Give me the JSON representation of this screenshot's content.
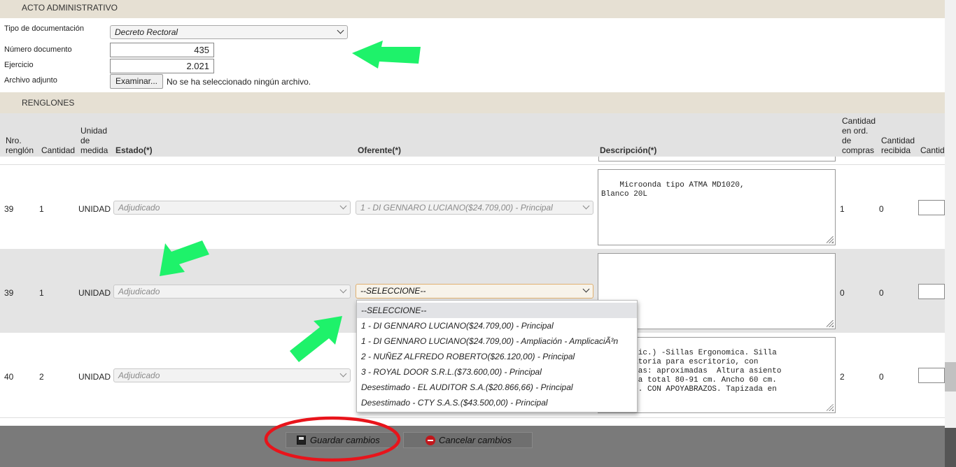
{
  "acto": {
    "header": "ACTO ADMINISTRATIVO",
    "tipo_label": "Tipo de documentación",
    "tipo_value": "Decreto Rectoral",
    "numero_label": "Número documento",
    "numero_value": "435",
    "ejercicio_label": "Ejercicio",
    "ejercicio_value": "2.021",
    "archivo_label": "Archivo adjunto",
    "examinar_label": "Examinar...",
    "archivo_status": "No se ha seleccionado ningún archivo."
  },
  "renglones": {
    "header": "RENGLONES",
    "columns": {
      "nro": "Nro.\nrenglón",
      "cantidad": "Cantidad",
      "unidad": "Unidad\nde\nmedida",
      "estado": "Estado(*)",
      "oferente": "Oferente(*)",
      "descripcion": "Descripción(*)",
      "cant_ord": "Cantidad\nen ord.\nde\ncompras",
      "cant_recibida": "Cantidad\nrecibida",
      "cant_extra": "Cantid"
    },
    "rows": [
      {
        "nro": "39",
        "cantidad": "1",
        "unidad": "UNIDAD",
        "estado": "Adjudicado",
        "oferente": "1 - DI GENNARO LUCIANO($24.709,00) - Principal",
        "descripcion": "Microonda tipo ATMA MD1020,\nBlanco 20L",
        "cant_ord": "1",
        "cant_recibida": "0"
      },
      {
        "nro": "39",
        "cantidad": "1",
        "unidad": "UNIDAD",
        "estado": "Adjudicado",
        "oferente": "--SELECCIONE--",
        "descripcion": "",
        "cant_ord": "0",
        "cant_recibida": "0"
      },
      {
        "nro": "40",
        "cantidad": "2",
        "unidad": "UNIDAD",
        "estado": "Adjudicado",
        "oferente": "",
        "descripcion": "a.Psic.) -Sillas Ergonomica. Silla\nica Giratoria para escritorio, con\ns. Medidas: aproximadas  Altura asiento\nn. Altura total 80-91 cm. Ancho 60 cm.\negulable. CON APOYABRAZOS. Tapizada en\n.-",
        "cant_ord": "2",
        "cant_recibida": "0"
      }
    ],
    "dropdown_options": [
      "--SELECCIONE--",
      "1 - DI GENNARO LUCIANO($24.709,00) - Principal",
      "1 - DI GENNARO LUCIANO($24.709,00) - Ampliación - AmplicaciÃ³n",
      "2 - NUÑEZ ALFREDO ROBERTO($26.120,00) - Principal",
      "3 - ROYAL DOOR S.R.L.($73.600,00) - Principal",
      "Desestimado - EL AUDITOR S.A.($20.866,66) - Principal",
      "Desestimado - CTY S.A.S.($43.500,00) - Principal"
    ]
  },
  "footer": {
    "guardar_label": "Guardar cambios",
    "cancelar_label": "Cancelar cambios"
  },
  "colors": {
    "section_header": "#e6e0d3",
    "annotation_arrow": "#1ef26a",
    "annotation_circle": "#e8141b",
    "footer_bg": "#7a7a7a"
  }
}
